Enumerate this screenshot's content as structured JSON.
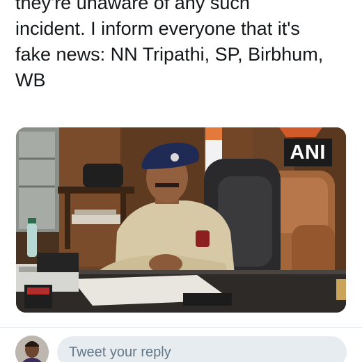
{
  "tweet": {
    "lines": [
      "they're unaware of any such",
      "incident. I inform everyone that it's",
      "fake news: NN Tripathi, SP, Birbhum,",
      "WB"
    ]
  },
  "media": {
    "watermark": "ANI",
    "description_icon": "video-frame"
  },
  "reply": {
    "placeholder": "Tweet your reply"
  },
  "colors": {
    "text": "#14171a",
    "placeholder": "#657786",
    "reply_bg": "#e6ecf0",
    "watermark_bg": "#1b1b1b"
  }
}
